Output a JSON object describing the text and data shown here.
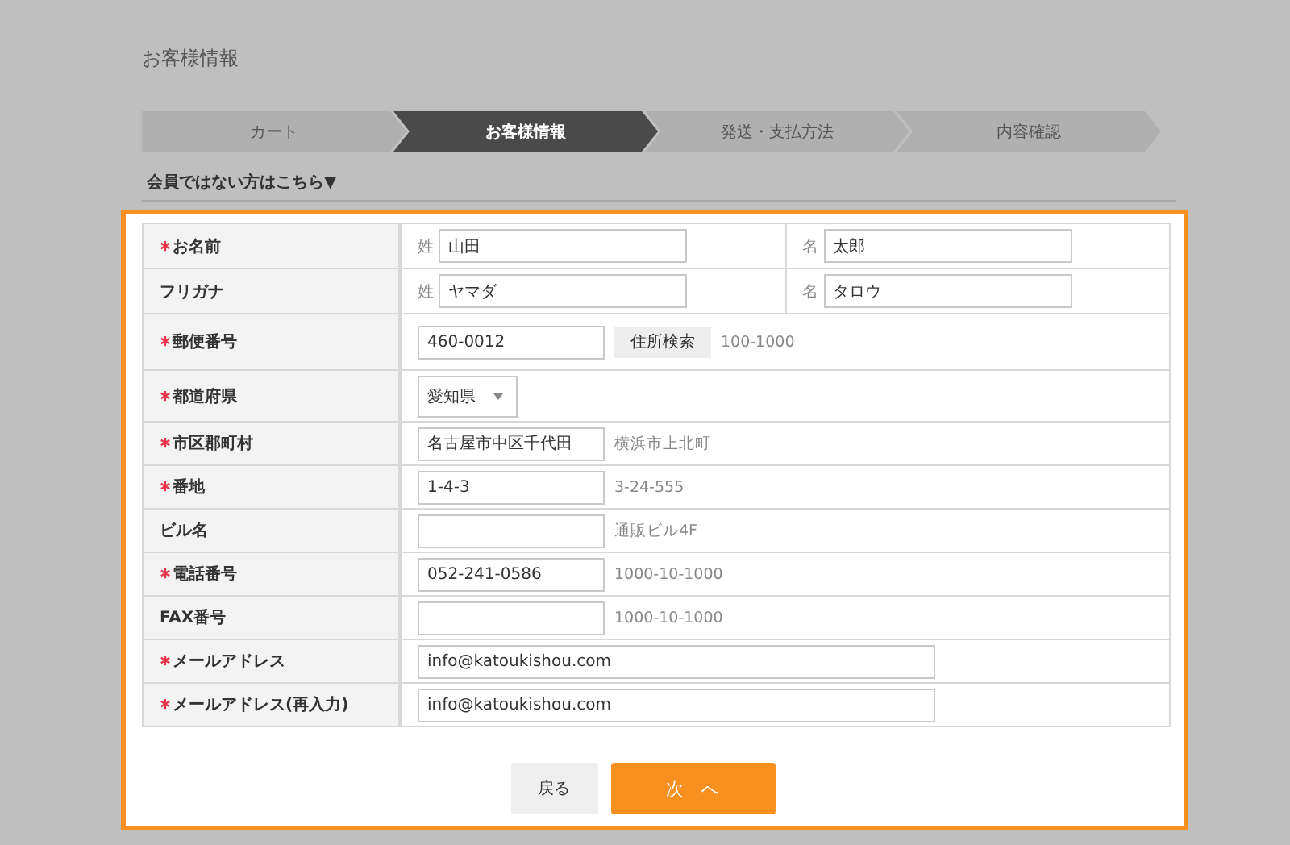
{
  "page_title": "お客様情報",
  "steps": [
    {
      "label": "カート",
      "selected": false
    },
    {
      "label": "お客様情報",
      "selected": true
    },
    {
      "label": "発送・支払方法",
      "selected": false
    },
    {
      "label": "内容確認",
      "selected": false
    }
  ],
  "member_link": "会員ではない方はこちら▼",
  "rows": [
    {
      "kind": "name",
      "label": "お名前",
      "required": true,
      "parts": [
        {
          "prefix": "姓",
          "value": "山田"
        },
        {
          "prefix": "名",
          "value": "太郎"
        }
      ]
    },
    {
      "kind": "name",
      "label": "フリガナ",
      "required": false,
      "parts": [
        {
          "prefix": "姓",
          "value": "ヤマダ"
        },
        {
          "prefix": "名",
          "value": "タロウ"
        }
      ]
    },
    {
      "kind": "postal",
      "label": "郵便番号",
      "required": true,
      "value": "460-0012",
      "button": "住所検索",
      "example": "100-1000"
    },
    {
      "kind": "select",
      "label": "都道府県",
      "required": true,
      "value": "愛知県"
    },
    {
      "kind": "text",
      "label": "市区郡町村",
      "required": true,
      "value": "名古屋市中区千代田",
      "example": "横浜市上北町"
    },
    {
      "kind": "text",
      "label": "番地",
      "required": true,
      "value": "1-4-3",
      "example": "3-24-555"
    },
    {
      "kind": "text",
      "label": "ビル名",
      "required": false,
      "value": "",
      "example": "通販ビル4F"
    },
    {
      "kind": "text",
      "label": "電話番号",
      "required": true,
      "value": "052-241-0586",
      "example": "1000-10-1000"
    },
    {
      "kind": "text",
      "label": "FAX番号",
      "required": false,
      "value": "",
      "example": "1000-10-1000"
    },
    {
      "kind": "wide",
      "label": "メールアドレス",
      "required": true,
      "value": "info@katoukishou.com"
    },
    {
      "kind": "wide",
      "label": "メールアドレス(再入力)",
      "required": true,
      "value": "info@katoukishou.com"
    }
  ],
  "back_button": "戻る",
  "next_button": "次　へ"
}
